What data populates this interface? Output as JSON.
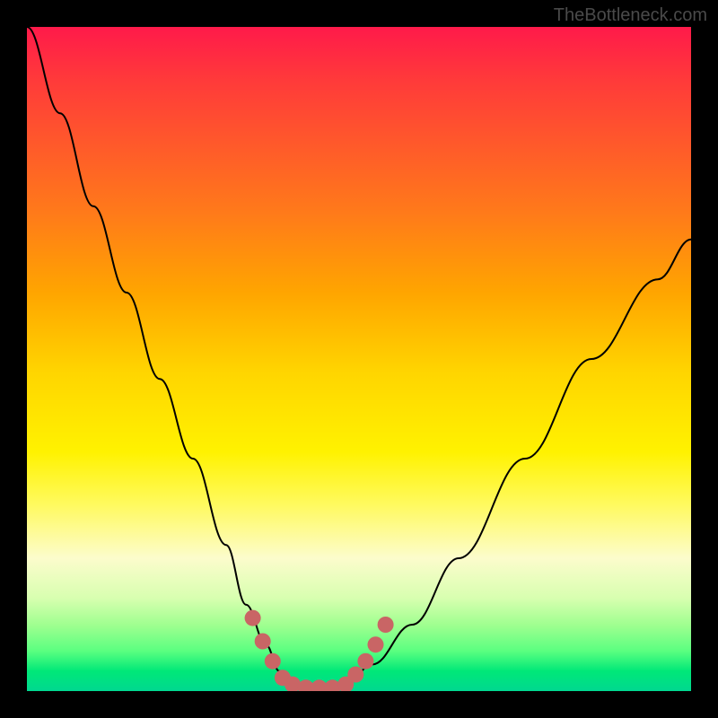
{
  "attribution": "TheBottleneck.com",
  "chart_data": {
    "type": "line",
    "title": "",
    "xlabel": "",
    "ylabel": "",
    "xlim": [
      0,
      100
    ],
    "ylim": [
      0,
      100
    ],
    "series": [
      {
        "name": "bottleneck-curve",
        "x": [
          0,
          5,
          10,
          15,
          20,
          25,
          30,
          33,
          36,
          38,
          40,
          42,
          44,
          48,
          52,
          58,
          65,
          75,
          85,
          95,
          100
        ],
        "y": [
          100,
          87,
          73,
          60,
          47,
          35,
          22,
          13,
          7,
          3,
          1,
          0,
          0,
          1,
          4,
          10,
          20,
          35,
          50,
          62,
          68
        ]
      }
    ],
    "annotations": [
      {
        "name": "valley-marker-dots",
        "color": "#c96565",
        "points": [
          {
            "x": 34,
            "y": 11
          },
          {
            "x": 35.5,
            "y": 7.5
          },
          {
            "x": 37,
            "y": 4.5
          },
          {
            "x": 38.5,
            "y": 2
          },
          {
            "x": 40,
            "y": 1
          },
          {
            "x": 42,
            "y": 0.5
          },
          {
            "x": 44,
            "y": 0.5
          },
          {
            "x": 46,
            "y": 0.5
          },
          {
            "x": 48,
            "y": 1
          },
          {
            "x": 49.5,
            "y": 2.5
          },
          {
            "x": 51,
            "y": 4.5
          },
          {
            "x": 52.5,
            "y": 7
          },
          {
            "x": 54,
            "y": 10
          }
        ]
      }
    ],
    "background": {
      "type": "vertical-gradient",
      "stops": [
        {
          "pos": 0,
          "color": "#ff1a4a"
        },
        {
          "pos": 100,
          "color": "#00d890"
        }
      ]
    }
  }
}
